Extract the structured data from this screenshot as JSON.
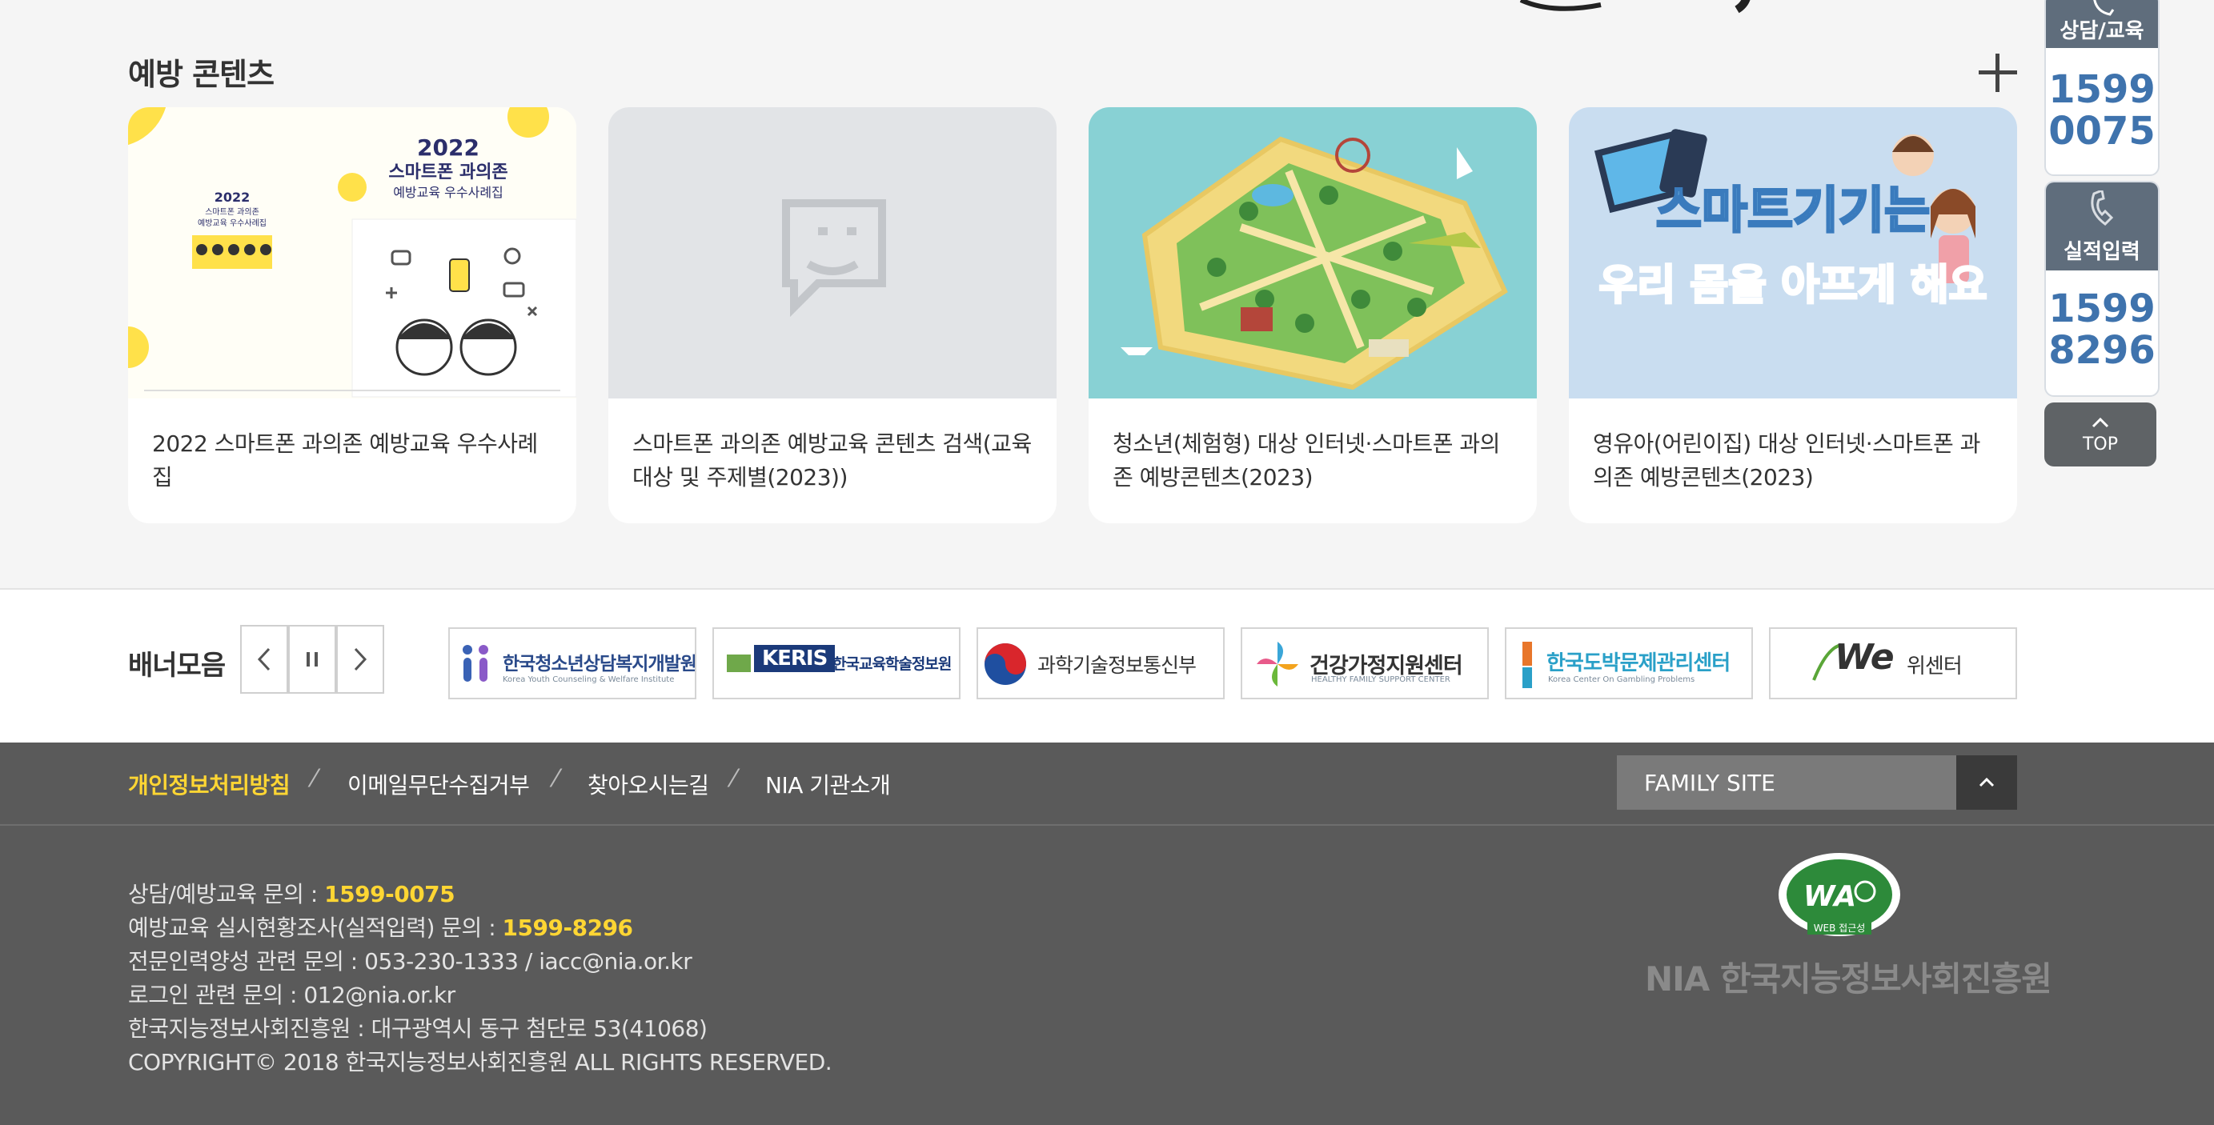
{
  "section": {
    "title": "예방 콘텐츠",
    "more_icon": "plus-icon"
  },
  "cards": [
    {
      "caption": "2022 스마트폰 과의존 예방교육 우수사례집",
      "thumb_title": "2022",
      "thumb_line1": "스마트폰 과의존",
      "thumb_line2": "예방교육 우수사례집",
      "thumb_small_title": "2022",
      "thumb_small_line1": "스마트폰 과의존",
      "thumb_small_line2": "예방교육 우수사례집"
    },
    {
      "caption": "스마트폰 과의존 예방교육 콘텐츠 검색(교육대상 및 주제별(2023))"
    },
    {
      "caption": "청소년(체험형) 대상 인터넷·스마트폰 과의존 예방콘텐츠(2023)"
    },
    {
      "caption": "영유아(어린이집) 대상 인터넷·스마트폰 과의존 예방콘텐츠(2023)",
      "thumb_line1": "스마트기기는",
      "thumb_line2": "우리 몸을 아프게 해요"
    }
  ],
  "quick_menu": [
    {
      "label": "상담/교육",
      "number_line1": "1599",
      "number_line2": "0075",
      "icon": "phone-icon"
    },
    {
      "label": "실적입력",
      "number_line1": "1599",
      "number_line2": "8296",
      "icon": "phone-icon"
    }
  ],
  "top_button": {
    "label": "TOP",
    "icon": "chevron-up-icon"
  },
  "banners": {
    "title": "배너모음",
    "controls": [
      "prev-icon",
      "pause-icon",
      "next-icon"
    ],
    "items": [
      {
        "label": "한국청소년상담복지개발원",
        "sub": "Korea Youth Counseling & Welfare Institute",
        "color": "#2a4a8a"
      },
      {
        "label": "KERIS",
        "label2": "한국교육학술정보원",
        "color": "#1b3a7a"
      },
      {
        "label": "과학기술정보통신부",
        "color": "#333333"
      },
      {
        "label": "건강가정지원센터",
        "sub": "HEALTHY FAMILY SUPPORT CENTER",
        "color": "#333333"
      },
      {
        "label": "한국도박문제관리센터",
        "sub": "Korea Center On Gambling Problems",
        "color": "#2aa0c8"
      },
      {
        "label": "We",
        "label2": "위센터",
        "color": "#333333"
      }
    ]
  },
  "footer": {
    "links": [
      "개인정보처리방침",
      "이메일무단수집거부",
      "찾아오시는길",
      "NIA 기관소개"
    ],
    "separator": "⁄",
    "family_site": "FAMILY SITE",
    "info": [
      {
        "text": "상담/예방교육 문의 : ",
        "highlight": "1599-0075"
      },
      {
        "text": "예방교육 실시현황조사(실적입력) 문의 : ",
        "highlight": "1599-8296"
      },
      {
        "text": "전문인력양성 관련 문의 : 053-230-1333 / iacc@nia.or.kr"
      },
      {
        "text": "로그인 관련 문의 : 012@nia.or.kr"
      },
      {
        "text": "한국지능정보사회진흥원 : 대구광역시 동구 첨단로 53(41068)"
      },
      {
        "text": "COPYRIGHT© 2018 한국지능정보사회진흥원 ALL RIGHTS RESERVED."
      }
    ],
    "wa_mark": "WA",
    "wa_text": "WEB 접근성",
    "org_logo": "NIA 한국지능정보사회진흥원"
  },
  "colors": {
    "accent_blue": "#3f73ad",
    "footer_bg": "#5a5a5a",
    "highlight": "#ffd633",
    "quick_head": "#5f6d7c"
  }
}
